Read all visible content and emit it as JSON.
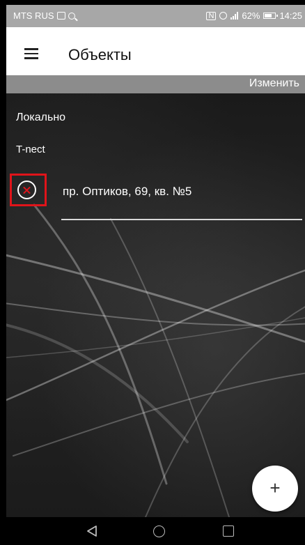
{
  "status_bar": {
    "carrier": "MTS RUS",
    "battery": "62%",
    "time": "14:25"
  },
  "app_bar": {
    "title": "Объекты",
    "menu_icon": "hamburger-icon"
  },
  "edit_bar": {
    "edit_label": "Изменить"
  },
  "list": {
    "section_local": "Локально",
    "group_name": "T-nect",
    "items": [
      {
        "label": "пр. Оптиков, 69, кв. №5",
        "remove_icon": "remove-circle-icon"
      }
    ]
  },
  "fab": {
    "label": "+"
  },
  "colors": {
    "highlight": "#e0141a",
    "edit_bar": "#8c8c8c",
    "status_bar": "#a7a7a7"
  }
}
